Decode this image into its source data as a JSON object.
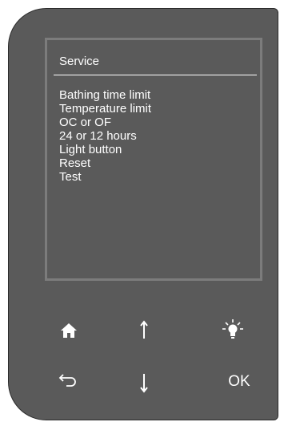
{
  "screen": {
    "title": "Service",
    "menu_items": [
      "Bathing time limit",
      "Temperature limit",
      "OC or OF",
      "24 or 12 hours",
      "Light button",
      "Reset",
      "Test"
    ]
  },
  "buttons": {
    "home_icon": "home-icon",
    "up_icon": "arrow-up-icon",
    "light_icon": "light-bulb-icon",
    "back_icon": "back-arrow-icon",
    "down_icon": "arrow-down-icon",
    "ok_label": "OK"
  },
  "colors": {
    "panel": "#5a5a5a",
    "screen_border": "#7c7c7c",
    "text": "#ffffff"
  }
}
